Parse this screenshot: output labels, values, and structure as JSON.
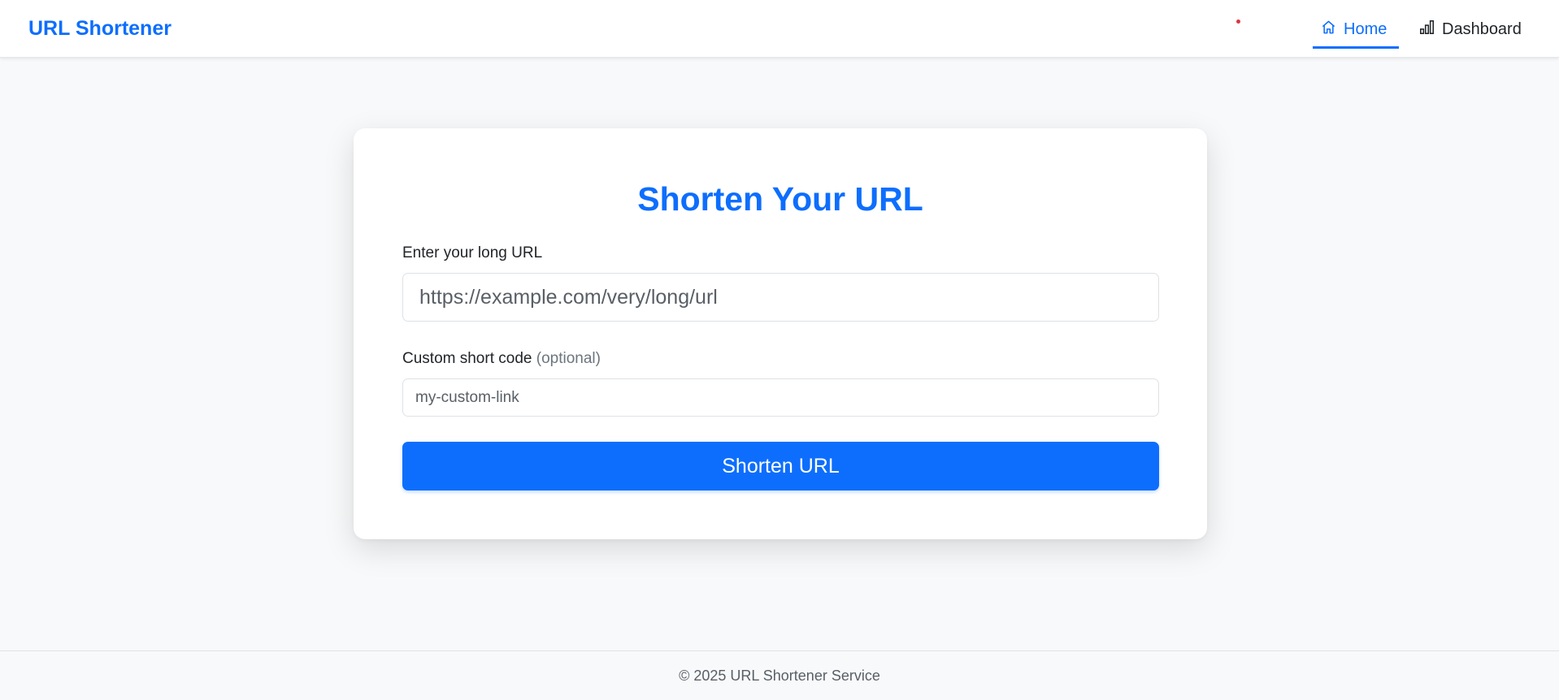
{
  "navbar": {
    "brand": "URL Shortener",
    "links": [
      {
        "label": "Home",
        "icon": "home-icon",
        "active": true
      },
      {
        "label": "Dashboard",
        "icon": "bar-chart-icon",
        "active": false
      }
    ]
  },
  "form": {
    "title": "Shorten Your URL",
    "url_label": "Enter your long URL",
    "url_placeholder": "https://example.com/very/long/url",
    "url_value": "",
    "code_label": "Custom short code",
    "code_label_hint": "(optional)",
    "code_placeholder": "my-custom-link",
    "code_value": "",
    "submit_label": "Shorten URL"
  },
  "footer": {
    "text": "© 2025 URL Shortener Service"
  },
  "colors": {
    "primary": "#0d6efd",
    "background": "#f8f9fa",
    "text": "#212529",
    "muted": "#6c757d",
    "indicator_dot": "#dc3545"
  }
}
